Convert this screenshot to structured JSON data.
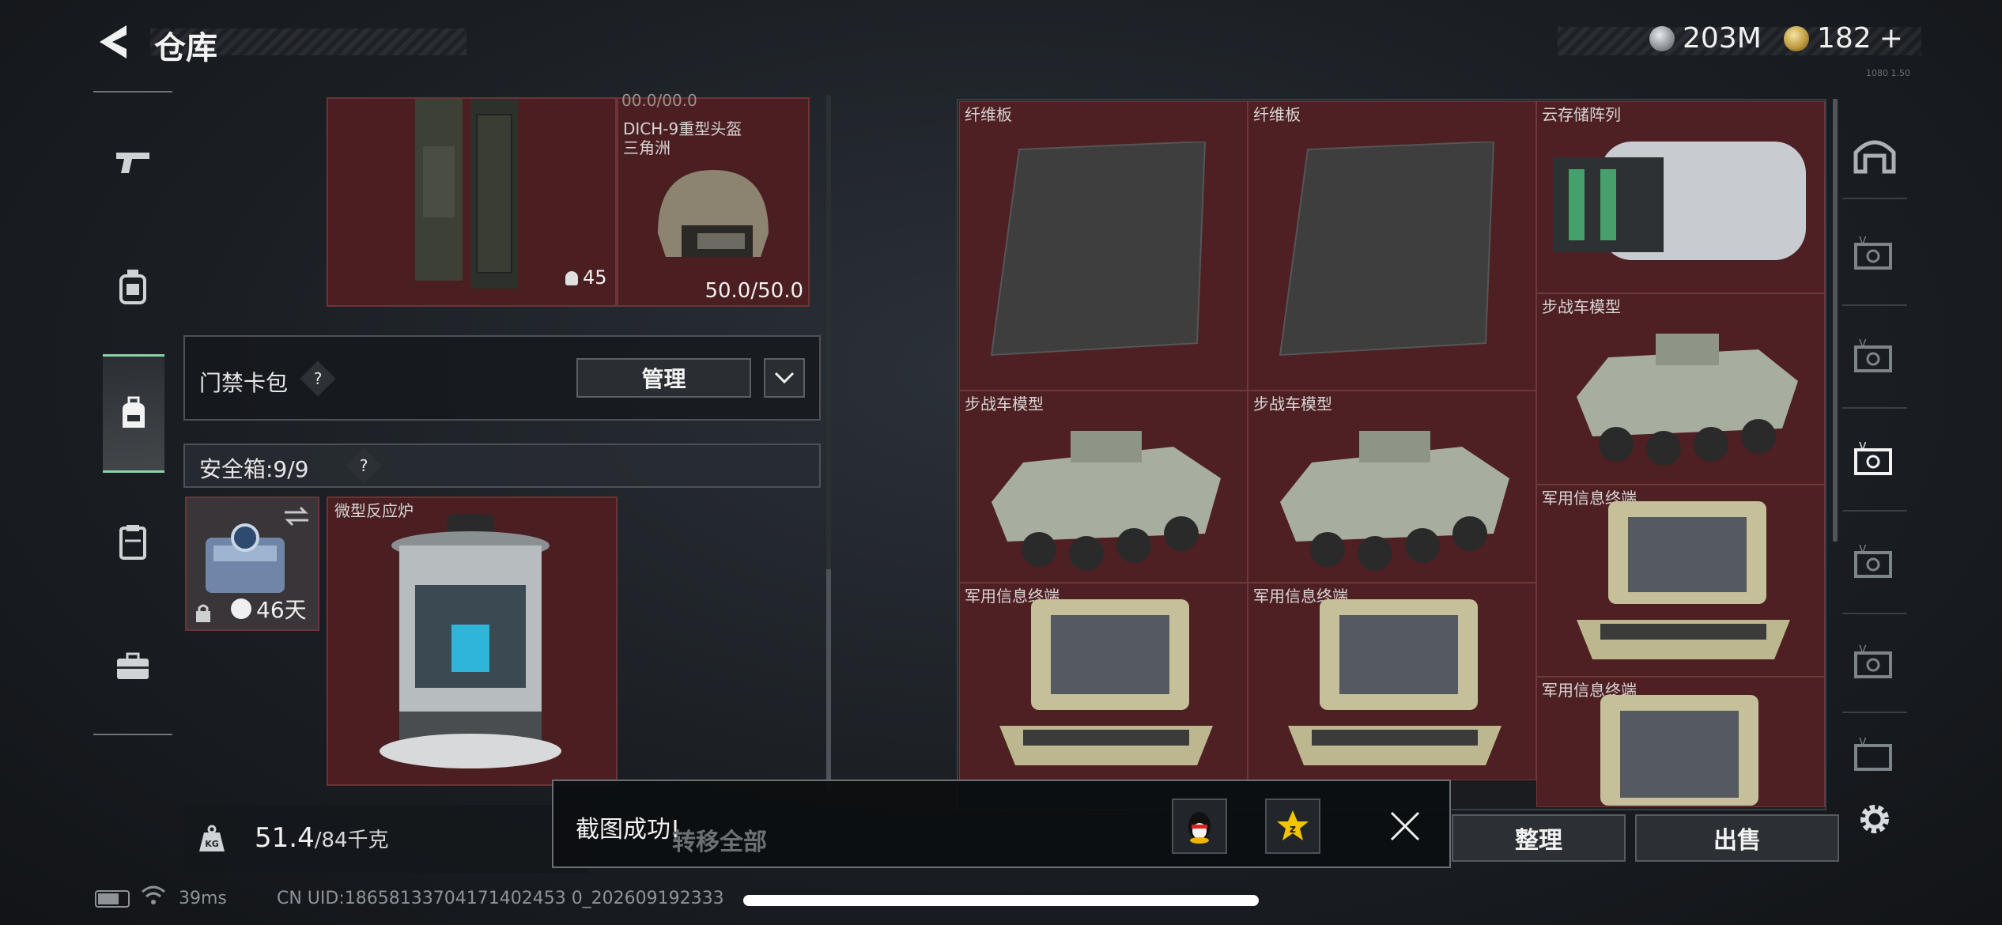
{
  "header": {
    "title": "仓库",
    "currency_silver": "203M",
    "currency_gold": "182",
    "add_label": "+",
    "small_tag": "1080 1.50"
  },
  "left_rail": {
    "items": [
      "firearms-icon",
      "backpack-icon",
      "bag-icon",
      "vest-icon",
      "toolbox-icon"
    ],
    "active_index": 2
  },
  "left_panel": {
    "top_tile_value": "00.0/00.0",
    "helmet_name": "DICH-9重型头盔",
    "helmet_map": "三角洲",
    "vest_count": "45",
    "helmet_durability": "50.0/50.0",
    "access_label": "门禁卡包",
    "help_q": "?",
    "manage_label": "管理",
    "safe_label": "安全箱:9/9",
    "safe_days": "46天",
    "reactor_name": "微型反应炉"
  },
  "weight": {
    "current": "51.4",
    "max": "/84千克"
  },
  "right_grid": {
    "tiles": [
      {
        "label": "纤维板"
      },
      {
        "label": "纤维板"
      },
      {
        "label": "云存储阵列"
      },
      {
        "label": "步战车模型"
      },
      {
        "label": "步战车模型"
      },
      {
        "label": "步战车模型"
      },
      {
        "label": "军用信息终端"
      },
      {
        "label": "军用信息终端"
      },
      {
        "label": "军用信息终端"
      },
      {
        "label": "军用信息终端"
      }
    ]
  },
  "buttons": {
    "transfer_all": "转移全部",
    "organize": "整理",
    "sell": "出售"
  },
  "toast": {
    "message": "截图成功!",
    "share_qq": "qq-share-icon",
    "share_qzone": "qzone-share-icon"
  },
  "status": {
    "ping": "39ms",
    "uid": "CN UID:18658133704171402453 0_202609192333"
  },
  "colors": {
    "tile_bg": "#4e2023",
    "accent_green": "#8ad3a6"
  }
}
